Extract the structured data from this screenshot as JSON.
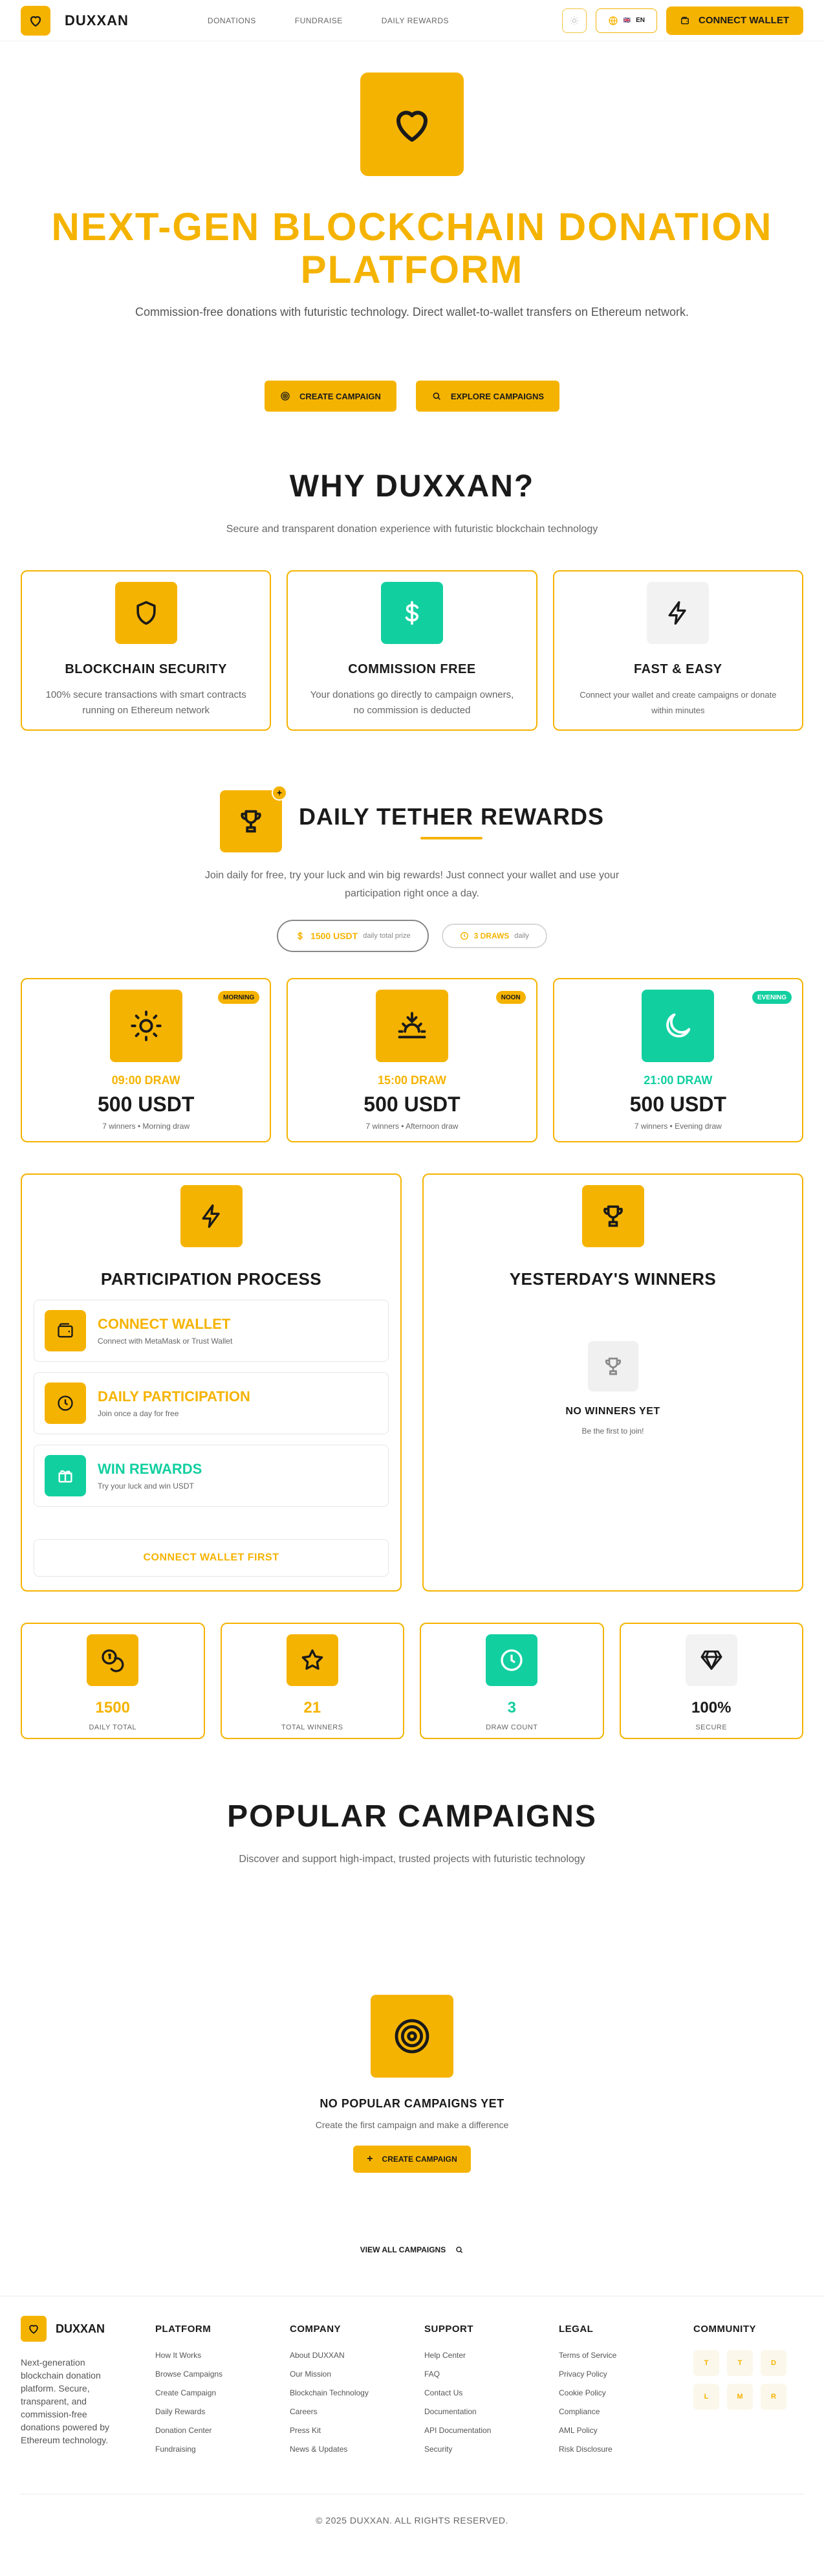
{
  "colors": {
    "accent": "#f5b301",
    "teal": "#12cfa0",
    "dark": "#1a1a1a",
    "muted": "#666666"
  },
  "header": {
    "brand": "DUXXAN",
    "nav": [
      "DONATIONS",
      "FUNDRAISE",
      "DAILY REWARDS"
    ],
    "lang": "EN",
    "lang_flag": "🇬🇧",
    "connect": "CONNECT WALLET"
  },
  "hero": {
    "title": "NEXT-GEN BLOCKCHAIN DONATION PLATFORM",
    "subtitle": "Commission-free donations with futuristic technology. Direct wallet-to-wallet transfers on Ethereum network.",
    "btn_create": "CREATE CAMPAIGN",
    "btn_explore": "EXPLORE CAMPAIGNS"
  },
  "why": {
    "title": "WHY DUXXAN?",
    "subtitle": "Secure and transparent donation experience with futuristic blockchain technology",
    "cards": [
      {
        "title": "BLOCKCHAIN SECURITY",
        "text": "100% secure transactions with smart contracts running on Ethereum network",
        "icon": "shield-icon"
      },
      {
        "title": "COMMISSION FREE",
        "text": "Your donations go directly to campaign owners, no commission is deducted",
        "icon": "dollar-icon"
      },
      {
        "title": "FAST & EASY",
        "text": "Connect your wallet and create campaigns or donate within minutes",
        "icon": "lightning-icon"
      }
    ]
  },
  "rewards": {
    "title": "DAILY TETHER REWARDS",
    "subtitle": "Join daily for free, try your luck and win big rewards! Just connect your wallet and use your participation right once a day.",
    "pill_prize": "1500 USDT",
    "pill_prize_sub": "daily total prize",
    "pill_draws": "3 DRAWS",
    "pill_draws_sub": "daily",
    "draws": [
      {
        "tag": "MORNING",
        "time": "09:00 DRAW",
        "amount": "500 USDT",
        "meta": "7 winners • Morning draw"
      },
      {
        "tag": "NOON",
        "time": "15:00 DRAW",
        "amount": "500 USDT",
        "meta": "7 winners • Afternoon draw"
      },
      {
        "tag": "EVENING",
        "time": "21:00 DRAW",
        "amount": "500 USDT",
        "meta": "7 winners • Evening draw"
      }
    ],
    "process": {
      "title": "PARTICIPATION PROCESS",
      "steps": [
        {
          "title": "CONNECT WALLET",
          "text": "Connect with MetaMask or Trust Wallet"
        },
        {
          "title": "DAILY PARTICIPATION",
          "text": "Join once a day for free"
        },
        {
          "title": "WIN REWARDS",
          "text": "Try your luck and win USDT"
        }
      ],
      "button": "CONNECT WALLET FIRST"
    },
    "winners": {
      "title": "YESTERDAY'S WINNERS",
      "empty_title": "NO WINNERS YET",
      "empty_sub": "Be the first to join!"
    },
    "stats": [
      {
        "value": "1500",
        "label": "DAILY TOTAL"
      },
      {
        "value": "21",
        "label": "TOTAL WINNERS"
      },
      {
        "value": "3",
        "label": "DRAW COUNT"
      },
      {
        "value": "100%",
        "label": "SECURE"
      }
    ]
  },
  "campaigns": {
    "title": "POPULAR CAMPAIGNS",
    "subtitle": "Discover and support high-impact, trusted projects with futuristic technology",
    "empty_title": "NO POPULAR CAMPAIGNS YET",
    "empty_sub": "Create the first campaign and make a difference",
    "create_btn": "CREATE CAMPAIGN",
    "view_all": "VIEW ALL CAMPAIGNS"
  },
  "footer": {
    "brand": "DUXXAN",
    "description": "Next-generation blockchain donation platform. Secure, transparent, and commission-free donations powered by Ethereum technology.",
    "columns": [
      {
        "title": "PLATFORM",
        "links": [
          "How It Works",
          "Browse Campaigns",
          "Create Campaign",
          "Daily Rewards",
          "Donation Center",
          "Fundraising"
        ]
      },
      {
        "title": "COMPANY",
        "links": [
          "About DUXXAN",
          "Our Mission",
          "Blockchain Technology",
          "Careers",
          "Press Kit",
          "News & Updates"
        ]
      },
      {
        "title": "SUPPORT",
        "links": [
          "Help Center",
          "FAQ",
          "Contact Us",
          "Documentation",
          "API Documentation",
          "Security"
        ]
      },
      {
        "title": "LEGAL",
        "links": [
          "Terms of Service",
          "Privacy Policy",
          "Cookie Policy",
          "Compliance",
          "AML Policy",
          "Risk Disclosure"
        ]
      }
    ],
    "community_title": "COMMUNITY",
    "social": [
      "T",
      "T",
      "D",
      "L",
      "M",
      "R"
    ],
    "copyright": "© 2025 DUXXAN. ALL RIGHTS RESERVED."
  }
}
